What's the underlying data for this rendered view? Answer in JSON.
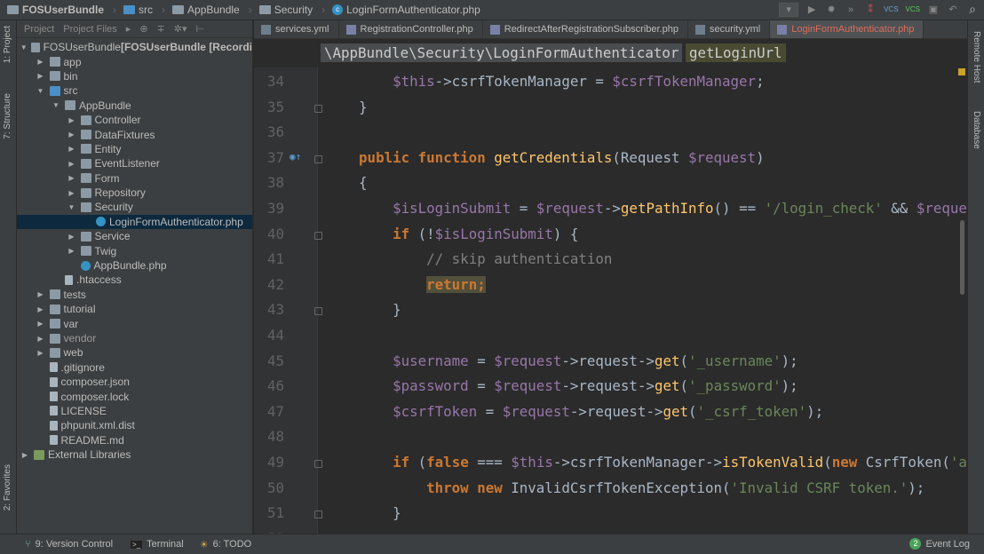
{
  "breadcrumb": [
    {
      "label": "FOSUserBundle",
      "icon": "folder-icon"
    },
    {
      "label": "src",
      "icon": "source-folder-icon"
    },
    {
      "label": "AppBundle",
      "icon": "folder-icon"
    },
    {
      "label": "Security",
      "icon": "folder-icon"
    },
    {
      "label": "LoginFormAuthenticator.php",
      "icon": "php-class-icon"
    }
  ],
  "toolbar": {
    "vcs1": "VCS",
    "vcs2": "VCS"
  },
  "left_strip": {
    "project": "1: Project",
    "structure": "7: Structure",
    "favorites": "2: Favorites"
  },
  "right_strip": {
    "remote": "Remote Host",
    "database": "Database"
  },
  "sidebar": {
    "tabs": [
      "Project",
      "Project Files"
    ],
    "items": [
      {
        "label": "FOSUserBundle",
        "suffix": " [FOSUserBundle [Recordi",
        "depth": 0,
        "arrow": "down",
        "icon": "folder"
      },
      {
        "label": "app",
        "depth": 1,
        "arrow": "right",
        "icon": "folder"
      },
      {
        "label": "bin",
        "depth": 1,
        "arrow": "right",
        "icon": "folder"
      },
      {
        "label": "src",
        "depth": 1,
        "arrow": "down",
        "icon": "src"
      },
      {
        "label": "AppBundle",
        "depth": 2,
        "arrow": "down",
        "icon": "folder"
      },
      {
        "label": "Controller",
        "depth": 3,
        "arrow": "right",
        "icon": "folder"
      },
      {
        "label": "DataFixtures",
        "depth": 3,
        "arrow": "right",
        "icon": "folder"
      },
      {
        "label": "Entity",
        "depth": 3,
        "arrow": "right",
        "icon": "folder"
      },
      {
        "label": "EventListener",
        "depth": 3,
        "arrow": "right",
        "icon": "folder"
      },
      {
        "label": "Form",
        "depth": 3,
        "arrow": "right",
        "icon": "folder"
      },
      {
        "label": "Repository",
        "depth": 3,
        "arrow": "right",
        "icon": "folder"
      },
      {
        "label": "Security",
        "depth": 3,
        "arrow": "down",
        "icon": "folder"
      },
      {
        "label": "LoginFormAuthenticator.php",
        "depth": 4,
        "arrow": "",
        "icon": "php",
        "selected": true
      },
      {
        "label": "Service",
        "depth": 3,
        "arrow": "right",
        "icon": "folder"
      },
      {
        "label": "Twig",
        "depth": 3,
        "arrow": "right",
        "icon": "folder"
      },
      {
        "label": "AppBundle.php",
        "depth": 3,
        "arrow": "",
        "icon": "php"
      },
      {
        "label": ".htaccess",
        "depth": 2,
        "arrow": "",
        "icon": "file"
      },
      {
        "label": "tests",
        "depth": 1,
        "arrow": "right",
        "icon": "folder"
      },
      {
        "label": "tutorial",
        "depth": 1,
        "arrow": "right",
        "icon": "folder"
      },
      {
        "label": "var",
        "depth": 1,
        "arrow": "right",
        "icon": "folder"
      },
      {
        "label": "vendor",
        "depth": 1,
        "arrow": "right",
        "icon": "folder",
        "dim": true
      },
      {
        "label": "web",
        "depth": 1,
        "arrow": "right",
        "icon": "folder"
      },
      {
        "label": ".gitignore",
        "depth": 1,
        "arrow": "",
        "icon": "file"
      },
      {
        "label": "composer.json",
        "depth": 1,
        "arrow": "",
        "icon": "file"
      },
      {
        "label": "composer.lock",
        "depth": 1,
        "arrow": "",
        "icon": "file"
      },
      {
        "label": "LICENSE",
        "depth": 1,
        "arrow": "",
        "icon": "file"
      },
      {
        "label": "phpunit.xml.dist",
        "depth": 1,
        "arrow": "",
        "icon": "file"
      },
      {
        "label": "README.md",
        "depth": 1,
        "arrow": "",
        "icon": "file"
      },
      {
        "label": "External Libraries",
        "depth": 0,
        "arrow": "right",
        "icon": "lib"
      }
    ]
  },
  "tabs": [
    {
      "label": "services.yml",
      "type": "yml"
    },
    {
      "label": "RegistrationController.php",
      "type": "php"
    },
    {
      "label": "RedirectAfterRegistrationSubscriber.php",
      "type": "php"
    },
    {
      "label": "security.yml",
      "type": "yml"
    },
    {
      "label": "LoginFormAuthenticator.php",
      "type": "php",
      "active": true
    }
  ],
  "editor_breadcrumb": {
    "path": "\\AppBundle\\Security\\LoginFormAuthenticator",
    "method": "getLoginUrl"
  },
  "code": [
    {
      "n": "34",
      "s": [
        [
          "        ",
          ""
        ],
        [
          "$this",
          "var"
        ],
        [
          "->csrfTokenManager = ",
          ""
        ],
        [
          "$csrfTokenManager",
          "var"
        ],
        [
          ";",
          ""
        ]
      ]
    },
    {
      "n": "35",
      "s": [
        [
          "    }",
          ""
        ]
      ],
      "fold": true
    },
    {
      "n": "36",
      "s": []
    },
    {
      "n": "37",
      "s": [
        [
          "    ",
          ""
        ],
        [
          "public function ",
          "kw"
        ],
        [
          "getCredentials",
          "fn"
        ],
        [
          "(Request ",
          ""
        ],
        [
          "$request",
          "var"
        ],
        [
          ")",
          ""
        ]
      ],
      "fold": true,
      "mark": true
    },
    {
      "n": "38",
      "s": [
        [
          "    {",
          ""
        ]
      ]
    },
    {
      "n": "39",
      "s": [
        [
          "        ",
          ""
        ],
        [
          "$isLoginSubmit",
          "var"
        ],
        [
          " = ",
          ""
        ],
        [
          "$request",
          "var"
        ],
        [
          "->",
          ""
        ],
        [
          "getPathInfo",
          "fn"
        ],
        [
          "() == ",
          ""
        ],
        [
          "'/login_check'",
          "str"
        ],
        [
          " && ",
          ""
        ],
        [
          "$reque",
          "var"
        ]
      ]
    },
    {
      "n": "40",
      "s": [
        [
          "        ",
          ""
        ],
        [
          "if ",
          "kw"
        ],
        [
          "(!",
          ""
        ],
        [
          "$isLoginSubmit",
          "var"
        ],
        [
          ") {",
          ""
        ]
      ],
      "fold": true
    },
    {
      "n": "41",
      "s": [
        [
          "            ",
          ""
        ],
        [
          "// skip authentication",
          "cm"
        ]
      ]
    },
    {
      "n": "42",
      "s": [
        [
          "            ",
          ""
        ],
        [
          "return;",
          "kw hl"
        ]
      ]
    },
    {
      "n": "43",
      "s": [
        [
          "        }",
          ""
        ]
      ],
      "fold": true
    },
    {
      "n": "44",
      "s": []
    },
    {
      "n": "45",
      "s": [
        [
          "        ",
          ""
        ],
        [
          "$username",
          "var"
        ],
        [
          " = ",
          ""
        ],
        [
          "$request",
          "var"
        ],
        [
          "->request->",
          ""
        ],
        [
          "get",
          "fn"
        ],
        [
          "(",
          ""
        ],
        [
          "'_username'",
          "str"
        ],
        [
          ");",
          ""
        ]
      ]
    },
    {
      "n": "46",
      "s": [
        [
          "        ",
          ""
        ],
        [
          "$password",
          "var"
        ],
        [
          " = ",
          ""
        ],
        [
          "$request",
          "var"
        ],
        [
          "->request->",
          ""
        ],
        [
          "get",
          "fn"
        ],
        [
          "(",
          ""
        ],
        [
          "'_password'",
          "str"
        ],
        [
          ");",
          ""
        ]
      ]
    },
    {
      "n": "47",
      "s": [
        [
          "        ",
          ""
        ],
        [
          "$csrfToken",
          "var"
        ],
        [
          " = ",
          ""
        ],
        [
          "$request",
          "var"
        ],
        [
          "->request->",
          ""
        ],
        [
          "get",
          "fn"
        ],
        [
          "(",
          ""
        ],
        [
          "'_csrf_token'",
          "str"
        ],
        [
          ");",
          ""
        ]
      ]
    },
    {
      "n": "48",
      "s": []
    },
    {
      "n": "49",
      "s": [
        [
          "        ",
          ""
        ],
        [
          "if ",
          "kw"
        ],
        [
          "(",
          ""
        ],
        [
          "false",
          "kw"
        ],
        [
          " === ",
          ""
        ],
        [
          "$this",
          "var"
        ],
        [
          "->csrfTokenManager->",
          ""
        ],
        [
          "isTokenValid",
          "fn"
        ],
        [
          "(",
          ""
        ],
        [
          "new ",
          "kw"
        ],
        [
          "CsrfToken(",
          ""
        ],
        [
          "'a",
          "str"
        ]
      ],
      "fold": true
    },
    {
      "n": "50",
      "s": [
        [
          "            ",
          ""
        ],
        [
          "throw new ",
          "kw"
        ],
        [
          "InvalidCsrfTokenException(",
          ""
        ],
        [
          "'Invalid CSRF token.'",
          "str"
        ],
        [
          ");",
          ""
        ]
      ]
    },
    {
      "n": "51",
      "s": [
        [
          "        }",
          ""
        ]
      ],
      "fold": true
    },
    {
      "n": "52",
      "s": []
    }
  ],
  "status": {
    "vcs": "9: Version Control",
    "terminal": "Terminal",
    "todo": "6: TODO",
    "event_log": "Event Log",
    "event_count": "2"
  }
}
